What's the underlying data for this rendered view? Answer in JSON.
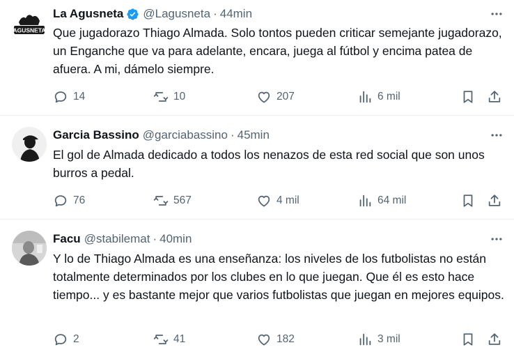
{
  "tweets": [
    {
      "name": "La Agusneta",
      "verified": true,
      "handle": "@Lagusneta",
      "time": "44min",
      "avatar_text": "AGUSNETA",
      "text": "Que jugadorazo Thiago Almada. Solo tontos pueden criticar semejante jugadorazo, un Enganche que va para adelante, encara, juega al fútbol y encima patea de afuera. A mi, dámelo siempre.",
      "replies": "14",
      "retweets": "10",
      "likes": "207",
      "views": "6 mil"
    },
    {
      "name": "Garcia Bassino",
      "verified": false,
      "handle": "@garciabassino",
      "time": "45min",
      "text": "El gol de Almada dedicado a todos los nenazos de esta red social que son unos burros a pedal.",
      "replies": "76",
      "retweets": "567",
      "likes": "4 mil",
      "views": "64 mil"
    },
    {
      "name": "Facu",
      "verified": false,
      "handle": "@stabilemat",
      "time": "40min",
      "text": "Y lo de Thiago Almada es una enseñanza: los niveles de los futbolistas no están totalmente determinados por los clubes en lo que juegan. Que él es esto hace tiempo... y es bastante mejor que varios futbolistas que juegan en mejores equipos.",
      "replies": "2",
      "retweets": "41",
      "likes": "182",
      "views": "3 mil"
    }
  ],
  "colors": {
    "text": "#0f1419",
    "secondary": "#536471",
    "verified": "#1d9bf0",
    "divider": "#eff3f4"
  },
  "icons": [
    "more-icon",
    "reply-icon",
    "retweet-icon",
    "like-icon",
    "views-icon",
    "bookmark-icon",
    "share-icon",
    "verified-badge-icon"
  ]
}
